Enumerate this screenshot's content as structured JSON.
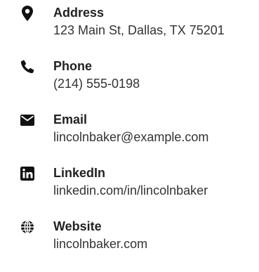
{
  "contact": {
    "icon_color": "#111111",
    "items": [
      {
        "icon": "map-marker-icon",
        "label": "Address",
        "value": "123 Main St, Dallas, TX 75201"
      },
      {
        "icon": "phone-icon",
        "label": "Phone",
        "value": "(214) 555-0198"
      },
      {
        "icon": "envelope-icon",
        "label": "Email",
        "value": "lincolnbaker@example.com"
      },
      {
        "icon": "linkedin-icon",
        "label": "LinkedIn",
        "value": "linkedin.com/in/lincolnbaker"
      },
      {
        "icon": "globe-icon",
        "label": "Website",
        "value": "lincolnbaker.com"
      }
    ]
  }
}
